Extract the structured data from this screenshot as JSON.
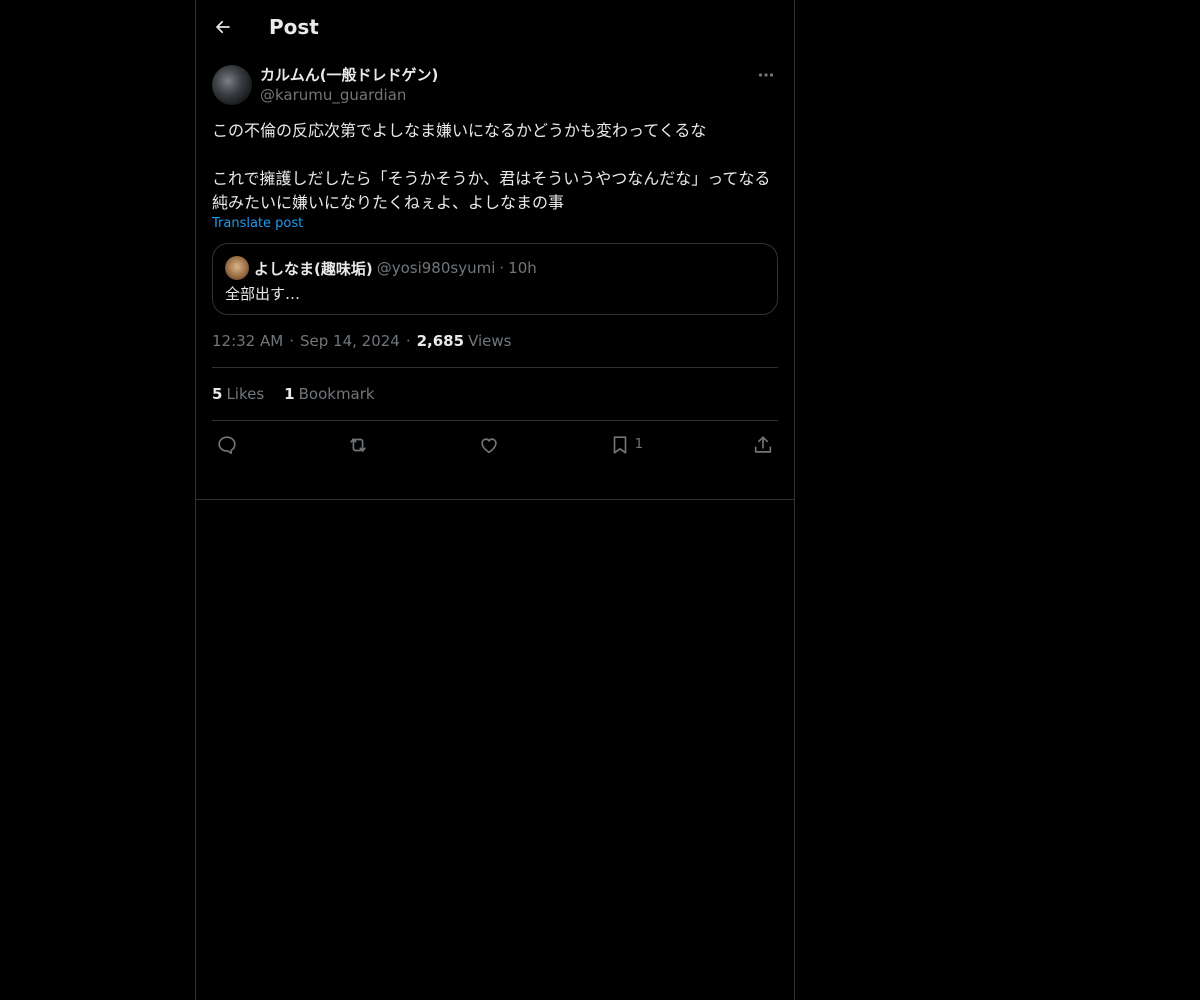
{
  "header": {
    "title": "Post"
  },
  "post": {
    "author": {
      "name": "カルムん(一般ドレドゲン)",
      "handle": "@karumu_guardian"
    },
    "text": "この不倫の反応次第でよしなま嫌いになるかどうかも変わってくるな\n\nこれで擁護しだしたら「そうかそうか、君はそういうやつなんだな」ってなる\n純みたいに嫌いになりたくねぇよ、よしなまの事",
    "translate_label": "Translate post",
    "quote": {
      "name": "よしなま(趣味垢)",
      "handle": "@yosi980syumi",
      "dot": "·",
      "time": "10h",
      "text": "全部出す…"
    },
    "time": "12:32 AM",
    "dot": "·",
    "date": "Sep 14, 2024",
    "views_count": "2,685",
    "views_label": "Views",
    "likes_count": "5",
    "likes_label": "Likes",
    "bookmarks_count": "1",
    "bookmarks_label": "Bookmark",
    "bookmark_action_count": "1"
  },
  "icons": {
    "back": "arrow-left-icon",
    "more": "more-horizontal-icon",
    "reply": "reply-icon",
    "repost": "repost-icon",
    "like": "heart-icon",
    "bookmark": "bookmark-icon",
    "share": "share-icon"
  },
  "colors": {
    "accent": "#1d9bf0",
    "background": "#000000",
    "border": "#2f3336",
    "muted": "#71767b",
    "text": "#e7e9ea"
  }
}
